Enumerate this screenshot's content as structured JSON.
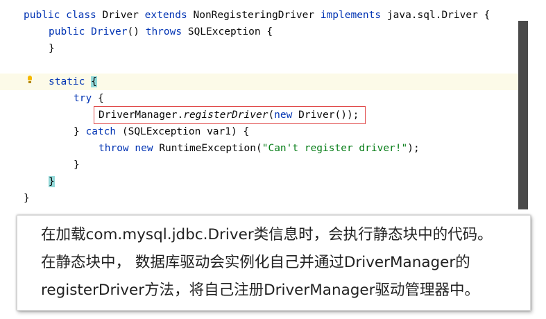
{
  "code": {
    "line1": {
      "public": "public",
      "class": "class",
      "name": "Driver",
      "extends": "extends",
      "parent": "NonRegisteringDriver",
      "implements": "implements",
      "iface": "java.sql.Driver",
      "brace": "{"
    },
    "line2": {
      "public": "public",
      "ctor": "Driver",
      "parens": "()",
      "throws": "throws",
      "exc": "SQLException",
      "brace": "{"
    },
    "line3": "}",
    "line5": {
      "static": "static",
      "brace": "{"
    },
    "line6": {
      "try": "try",
      "brace": "{"
    },
    "line7": {
      "manager": "DriverManager.",
      "method": "registerDriver",
      "open": "(",
      "new": "new",
      "rest": "Driver());"
    },
    "line8": {
      "close": "}",
      "catch": "catch",
      "args": "(SQLException var1) {"
    },
    "line9": {
      "throw": "throw",
      "new": "new",
      "ctor": "RuntimeException(",
      "message": "\"Can't register driver!\"",
      "end": ");"
    },
    "line10": "}",
    "line11": "}",
    "line12": "}"
  },
  "caption": {
    "line1": "在加载com.mysql.jdbc.Driver类信息时，会执行静态块中的代码。",
    "line2": "在静态块中， 数据库驱动会实例化自己并通过DriverManager的",
    "line3": "registerDriver方法，将自己注册DriverManager驱动管理器中。"
  }
}
